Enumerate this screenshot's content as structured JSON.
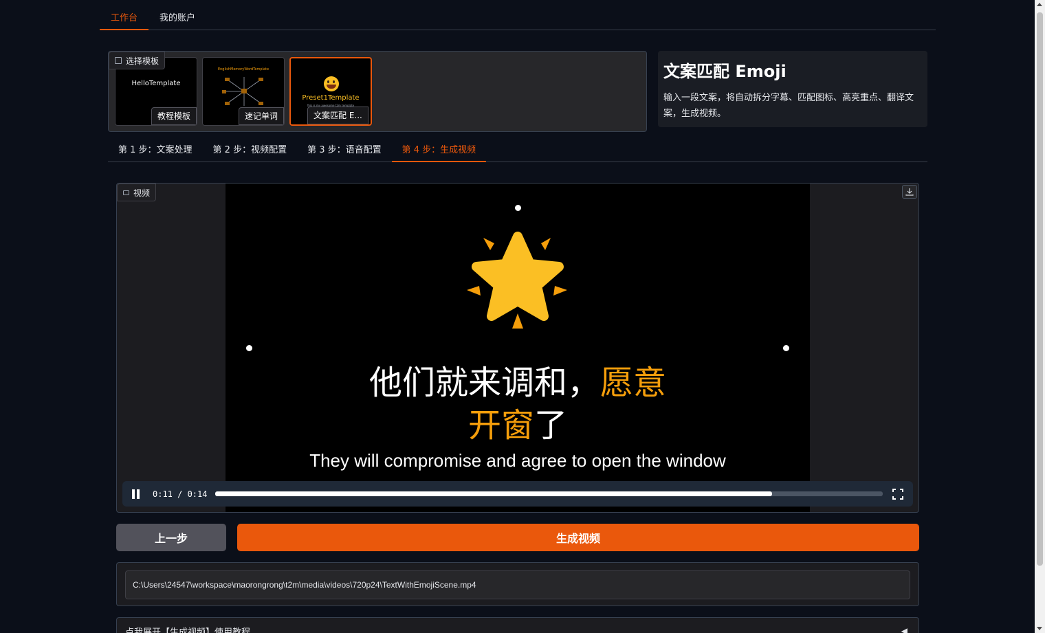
{
  "top_tabs": [
    {
      "label": "工作台",
      "active": true
    },
    {
      "label": "我的账户",
      "active": false
    }
  ],
  "template_panel": {
    "label": "选择模板",
    "templates": [
      {
        "caption": "教程模板",
        "thumb_title": "HelloTemplate"
      },
      {
        "caption": "速记单词",
        "thumb_title": "EnglishMemoryWordTemplate"
      },
      {
        "caption": "文案匹配 E...",
        "thumb_title": "Preset1Template",
        "thumb_sub": "this is my awesome t2m template",
        "selected": true
      }
    ]
  },
  "info": {
    "title": "文案匹配 Emoji",
    "description": "输入一段文案，将自动拆分字幕、匹配图标、高亮重点、翻译文案，生成视频。"
  },
  "step_tabs": [
    {
      "label": "第 1 步：文案处理",
      "active": false
    },
    {
      "label": "第 2 步：视频配置",
      "active": false
    },
    {
      "label": "第 3 步：语音配置",
      "active": false
    },
    {
      "label": "第 4 步：生成视频",
      "active": true
    }
  ],
  "video": {
    "label": "视频",
    "subtitle_line1_plain": "他们就来调和，",
    "subtitle_line1_highlight": "愿意",
    "subtitle_line2_highlight": "开窗",
    "subtitle_line2_plain": "了",
    "english_subtitle": "They will compromise and agree to open the window",
    "time": "0:11 / 0:14",
    "progress": 0.834,
    "colors": {
      "highlight": "#f59e0b",
      "star": "#fbbf24"
    }
  },
  "buttons": {
    "prev": "上一步",
    "generate": "生成视频"
  },
  "output_path": "C:\\Users\\24547\\workspace\\maorongrong\\t2m\\media\\videos\\720p24\\TextWithEmojiScene.mp4",
  "accordion": {
    "label": "点我展开【生成视频】使用教程",
    "arrow": "◀"
  },
  "theme": {
    "accent": "#ea580c",
    "background": "#0b0f19"
  }
}
